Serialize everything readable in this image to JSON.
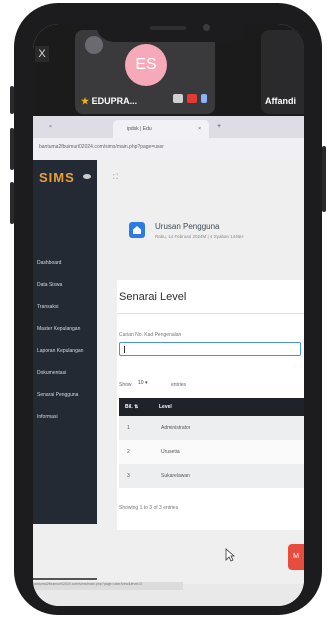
{
  "call": {
    "close": "X",
    "main_tile": {
      "initials": "ES",
      "name": "EDUPRA..."
    },
    "right_tile": {
      "name": "Affandi"
    }
  },
  "browser": {
    "tab_title": "ipdsk | Edu",
    "tab_close": "×",
    "new_tab": "+",
    "url": "bantuma2fbuimuri02024.com/sims/main.php?page=user"
  },
  "app": {
    "logo": "SIMS",
    "nav_items": [
      "Dashboard",
      "Data Siswa",
      "Transaksi",
      "Master Kepulangan",
      "Laporan Kepulangan",
      "Dokumentasi",
      "Senarai Pengguna",
      "Informasi"
    ],
    "header": {
      "title": "Urusan Pengguna",
      "subtitle": "Rabu, 14 Februari 2024M | 4 Syaban 1445H"
    },
    "panel_title": "Senarai Level",
    "search_label": "Carian No. Kad Pengenalan",
    "show_label": "Show",
    "entries_value": "10",
    "entries_label": "entries",
    "table": {
      "headers": [
        "Bil.",
        "Level"
      ],
      "rows": [
        [
          "1",
          "Administrator"
        ],
        [
          "2",
          "Urusetia"
        ],
        [
          "3",
          "Sukarelawan"
        ]
      ]
    },
    "info": "Showing 1 to 3 of 3 entries"
  },
  "status_url": "bantuma2fbuimuri02024.com/sims/main.php?page=user/view&level=3",
  "red_tab_label": "M"
}
